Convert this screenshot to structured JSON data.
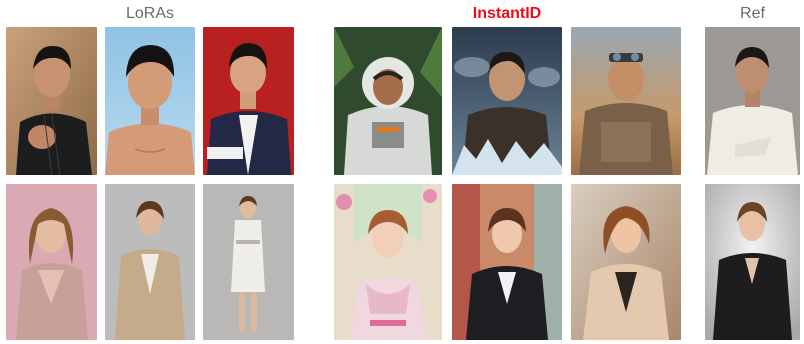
{
  "headers": {
    "loras": "LoRAs",
    "instantid": "InstantID",
    "ref": "Ref"
  },
  "colors": {
    "header_gray": "#6a6a6a",
    "instantid_red": "#e8101a"
  },
  "rows": [
    {
      "subject": "male",
      "loras": [
        "man-fist-pose-photo",
        "man-shirtless-photo",
        "man-jacket-photo"
      ],
      "instantid": [
        "man-astronaut-jungle",
        "man-ice-fantasy",
        "man-desert-explorer"
      ],
      "ref": "man-white-suit-reference"
    },
    {
      "subject": "female",
      "loras": [
        "woman-floral-dress-photo",
        "woman-beige-suit-photo",
        "woman-white-dress-photo"
      ],
      "instantid": [
        "woman-princess-garden",
        "woman-black-suit-art",
        "woman-beige-blazer-art"
      ],
      "ref": "woman-black-suit-reference"
    }
  ]
}
